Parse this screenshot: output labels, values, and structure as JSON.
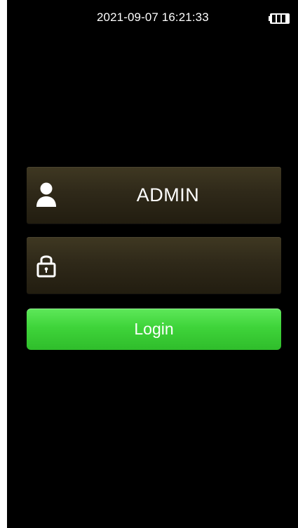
{
  "status_bar": {
    "datetime": "2021-09-07 16:21:33",
    "battery_icon": "battery-full-icon"
  },
  "login_form": {
    "username": {
      "icon": "user-icon",
      "value": "ADMIN"
    },
    "password": {
      "icon": "lock-icon",
      "value": ""
    },
    "login_button": {
      "label": "Login"
    }
  },
  "colors": {
    "background": "#000000",
    "field_background": "#2f2919",
    "login_button": "#3fd43a",
    "text": "#ffffff"
  }
}
